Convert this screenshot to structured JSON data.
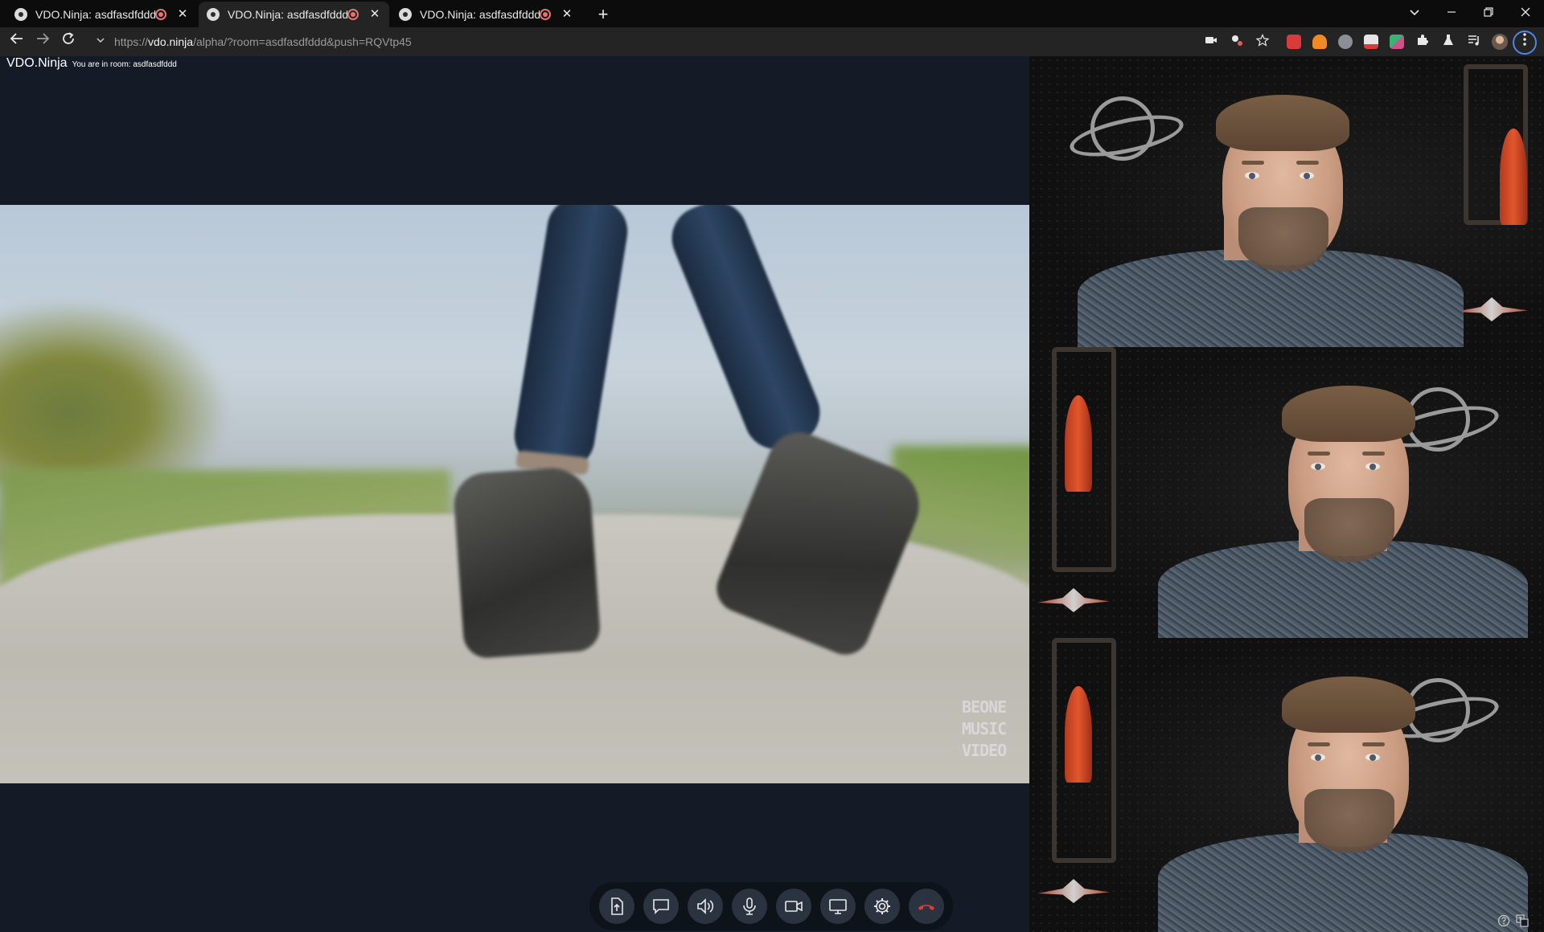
{
  "tabs": [
    {
      "title": "VDO.Ninja: asdfasdfddd",
      "active": false
    },
    {
      "title": "VDO.Ninja: asdfasdfddd",
      "active": true
    },
    {
      "title": "VDO.Ninja: asdfasdfddd",
      "active": false
    }
  ],
  "address": {
    "scheme": "https://",
    "host": "vdo.ninja",
    "path": "/alpha/?room=asdfasdfddd&push=RQVtp45"
  },
  "page": {
    "brand": "VDO.Ninja",
    "room_text": "You are in room: asdfasdfddd"
  },
  "main_video": {
    "watermark_lines": [
      "BEONE",
      "MUSIC",
      "VIDEO"
    ]
  },
  "icons": {
    "back": "arrow-left-icon",
    "forward": "arrow-right-icon",
    "reload": "reload-icon",
    "site_info": "chevron-down-icon",
    "camera_indicator": "camera-icon",
    "bookmark": "star-icon",
    "extensions": "puzzle-icon",
    "menu": "kebab-menu-icon"
  },
  "colors": {
    "page_background": "#141a26",
    "control_button": "#2c3340",
    "hangup": "#e53935",
    "recording": "#e57373",
    "accent": "#4f86e8"
  }
}
